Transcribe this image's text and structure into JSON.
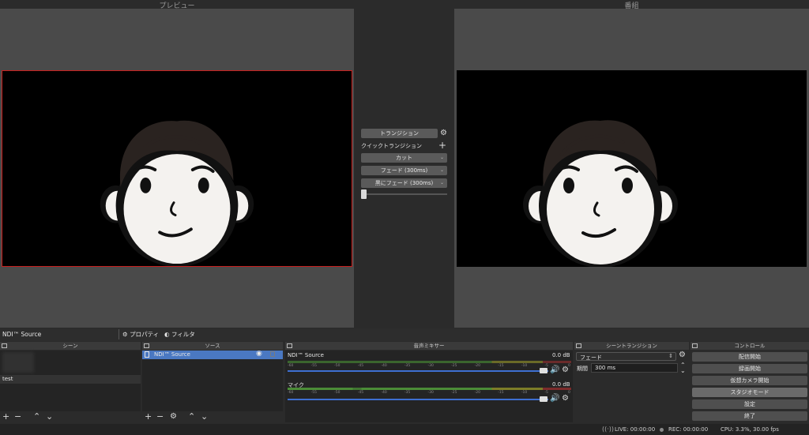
{
  "preview": {
    "title": "プレビュー"
  },
  "program": {
    "title": "番組"
  },
  "transitions": {
    "transition_button": "トランジション",
    "quick_label": "クイックトランジション",
    "items": [
      "カット",
      "フェード (300ms)",
      "黒にフェード (300ms)"
    ]
  },
  "source_bar": {
    "selected_source": "NDI™ Source",
    "properties": "プロパティ",
    "filters": "フィルタ"
  },
  "scenes": {
    "title": "シーン",
    "items": [
      "test"
    ]
  },
  "sources": {
    "title": "ソース",
    "items": [
      "NDI™ Source"
    ]
  },
  "mixer": {
    "title": "音声ミキサー",
    "tracks": [
      {
        "name": "NDI™ Source",
        "level": "0.0 dB",
        "volume": 0.94
      },
      {
        "name": "マイク",
        "level": "0.0 dB",
        "volume": 0.94
      }
    ],
    "ticks": [
      "-60",
      "-55",
      "-50",
      "-45",
      "-40",
      "-35",
      "-30",
      "-25",
      "-20",
      "-15",
      "-10",
      "-5",
      "0"
    ]
  },
  "scene_transition": {
    "title": "シーントランジション",
    "type": "フェード",
    "duration_label": "期間",
    "duration_value": "300 ms"
  },
  "controls": {
    "title": "コントロール",
    "buttons": [
      "配信開始",
      "録画開始",
      "仮想カメラ開始",
      "スタジオモード",
      "設定",
      "終了"
    ]
  },
  "status": {
    "live": "LIVE: 00:00:00",
    "rec": "REC: 00:00:00",
    "cpu": "CPU: 3.3%, 30.00 fps"
  },
  "colors": {
    "selection_red": "#c8201e",
    "selected_row": "#4a78c2",
    "meter_green": "#4d9a37",
    "meter_yellow": "#a3a32a",
    "meter_red": "#a33030",
    "volume_blue": "#3e6fd1"
  }
}
